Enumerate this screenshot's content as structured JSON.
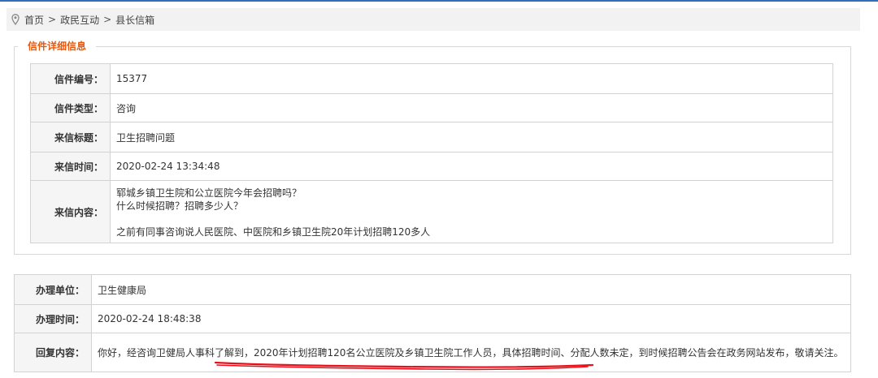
{
  "breadcrumb": {
    "items": [
      "首页",
      "政民互动",
      "县长信箱"
    ],
    "separator": ">"
  },
  "detail": {
    "legend": "信件详细信息",
    "rows": [
      {
        "label": "信件编号：",
        "value": "15377"
      },
      {
        "label": "信件类型：",
        "value": "咨询"
      },
      {
        "label": "来信标题：",
        "value": "卫生招聘问题"
      },
      {
        "label": "来信时间：",
        "value": "2020-02-24 13:34:48"
      },
      {
        "label": "来信内容：",
        "lines": [
          "郓城乡镇卫生院和公立医院今年会招聘吗？",
          "什么时候招聘？招聘多少人？",
          "",
          "之前有同事咨询说人民医院、中医院和乡镇卫生院20年计划招聘120多人"
        ]
      }
    ]
  },
  "reply": {
    "rows": [
      {
        "label": "办理单位：",
        "value": "卫生健康局"
      },
      {
        "label": "办理时间：",
        "value": "2020-02-24 18:48:38"
      },
      {
        "label": "回复内容：",
        "value": "你好，经咨询卫健局人事科了解到，2020年计划招聘120名公立医院及乡镇卫生院工作人员，具体招聘时间、分配人数未定，到时候招聘公告会在政务网站发布，敬请关注。"
      }
    ]
  },
  "colors": {
    "accent": "#e8580c",
    "title_red": "#e00000",
    "annotation_red": "#e8101a",
    "label_bg": "#f5f5f5",
    "border": "#d3d3d3"
  },
  "icons": {
    "breadcrumb": "location-pin-icon"
  }
}
